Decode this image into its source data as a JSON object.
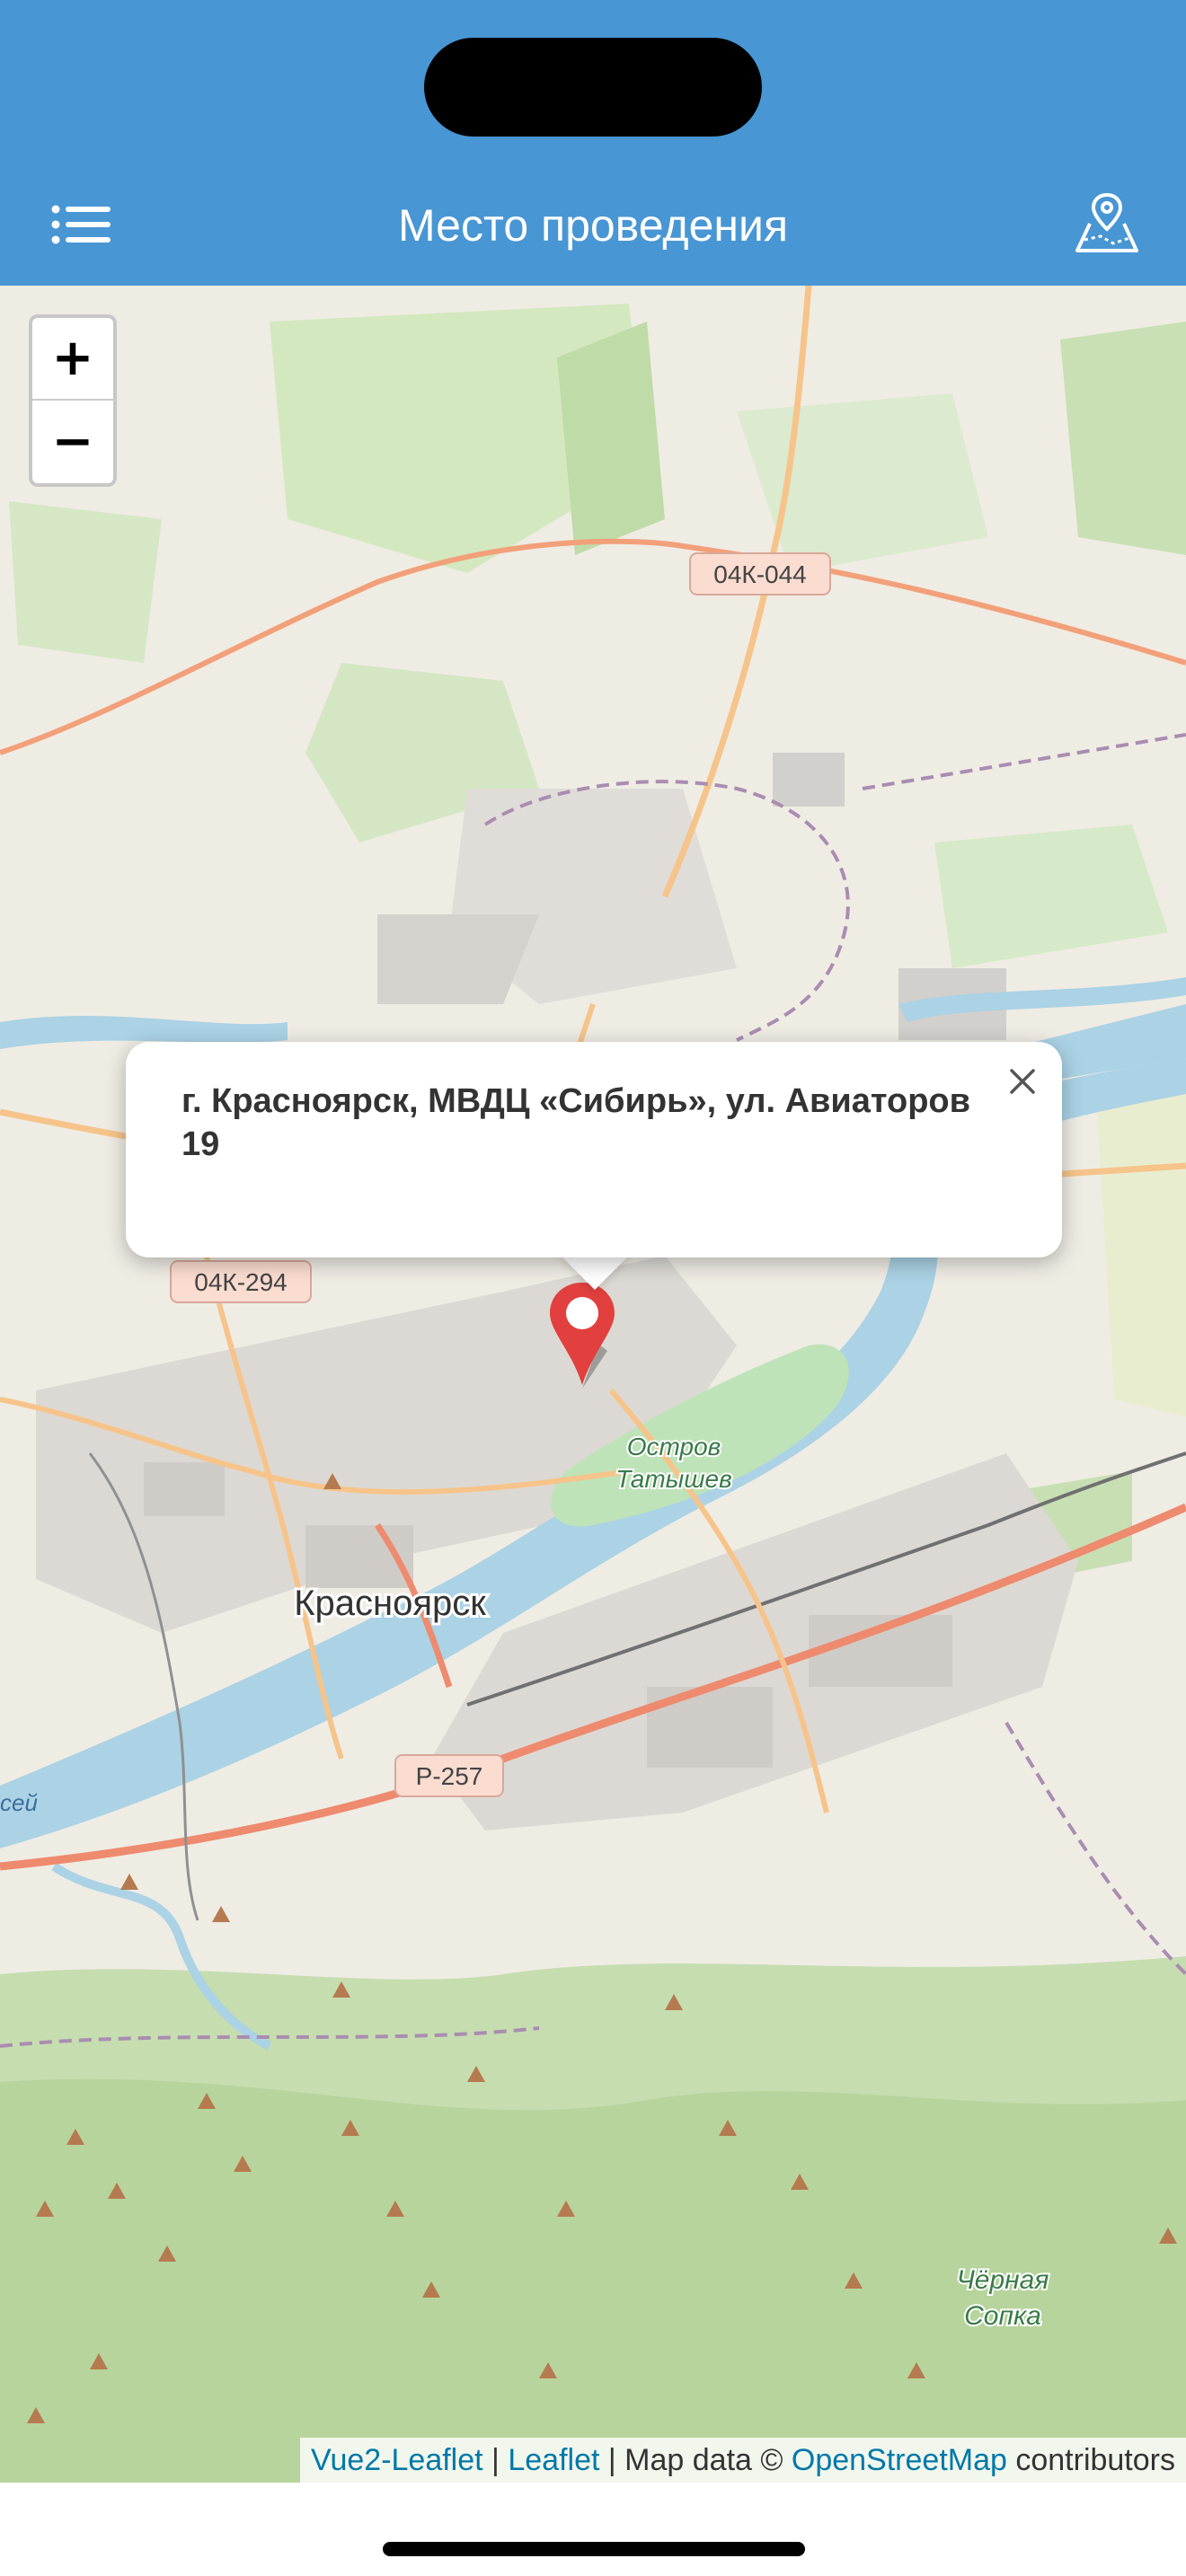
{
  "header": {
    "title": "Место проведения",
    "background": "#4896d4",
    "menu_icon": "list-icon",
    "right_icon": "map-pin-icon"
  },
  "map": {
    "zoom_in_label": "+",
    "zoom_out_label": "−",
    "labels": {
      "road_04k044": "04К-044",
      "road_04k294": "04К-294",
      "road_r257": "Р-257",
      "city": "Красноярск",
      "island_line1": "Остров",
      "island_line2": "Татышев",
      "mountain_line1": "Чёрная",
      "mountain_line2": "Сопка",
      "river_fragment": "сей"
    },
    "popup": {
      "text": "г. Красноярск, МВДЦ «Сибирь», ул. Авиаторов 19",
      "close_icon": "close-icon"
    },
    "marker_color": "#e1403f",
    "attribution": {
      "link1": "Vue2-Leaflet",
      "sep1": " | ",
      "link2": "Leaflet",
      "text_mid": " | Map data © ",
      "link3": "OpenStreetMap",
      "text_end": " contributors"
    }
  }
}
